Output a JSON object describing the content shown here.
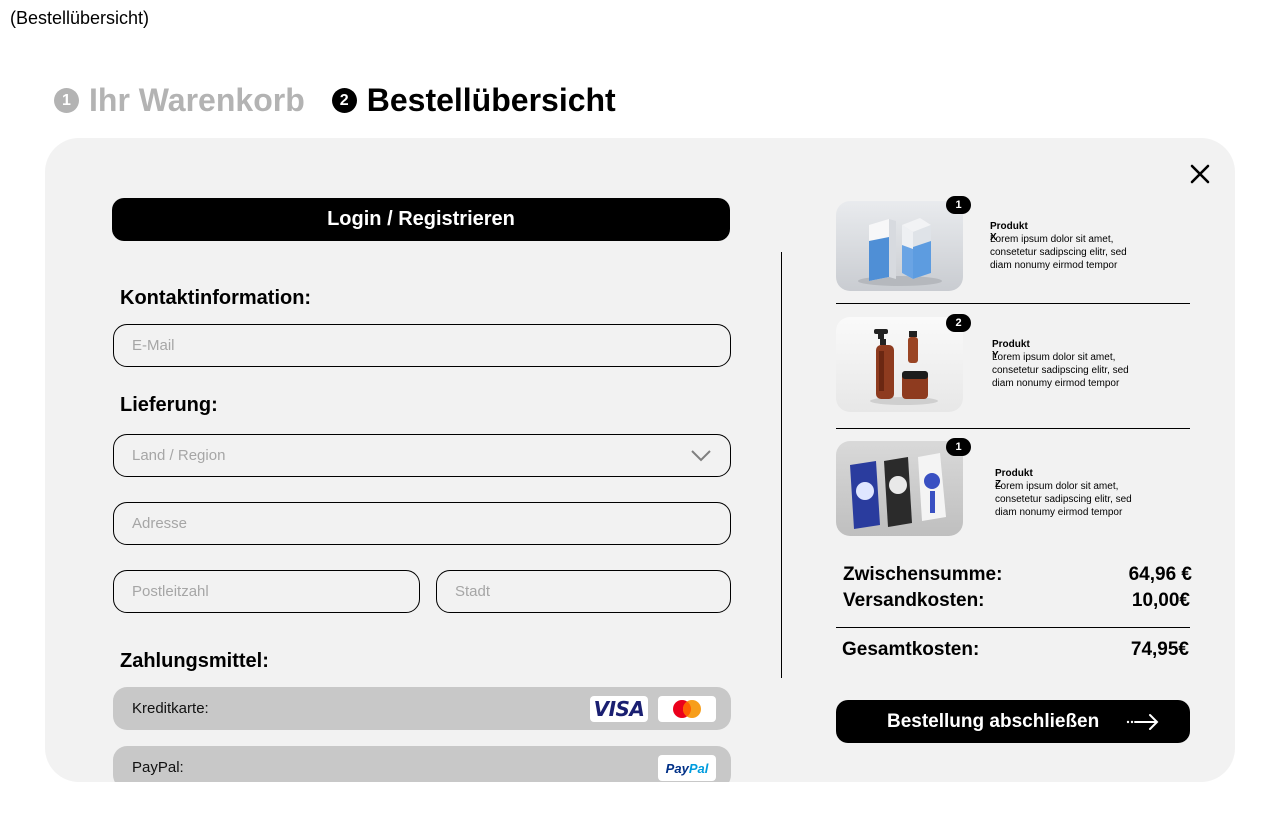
{
  "frame_label": "(Bestellübersicht)",
  "steps": [
    {
      "number": "1",
      "label": "Ihr Warenkorb"
    },
    {
      "number": "2",
      "label": "Bestellübersicht"
    }
  ],
  "form": {
    "login_label": "Login / Registrieren",
    "contact_title": "Kontaktinformation:",
    "email_placeholder": "E-Mail",
    "delivery_title": "Lieferung:",
    "country_placeholder": "Land / Region",
    "address_placeholder": "Adresse",
    "zip_placeholder": "Postleitzahl",
    "city_placeholder": "Stadt",
    "payment_title": "Zahlungsmittel:",
    "payment_options": [
      {
        "label": "Kreditkarte:"
      },
      {
        "label": "PayPal:"
      }
    ],
    "logos": {
      "visa": "VISA",
      "paypal_a": "Pay",
      "paypal_b": "Pal"
    }
  },
  "products": [
    {
      "qty": "1",
      "name": "Produkt X",
      "desc": "Lorem ipsum dolor sit amet, consetetur sadipscing elitr, sed diam nonumy eirmod tempor"
    },
    {
      "qty": "2",
      "name": "Produkt Y",
      "desc": "Lorem ipsum dolor sit amet, consetetur sadipscing elitr, sed diam nonumy eirmod tempor"
    },
    {
      "qty": "1",
      "name": "Produkt Z",
      "desc": "Lorem ipsum dolor sit amet, consetetur sadipscing elitr, sed diam nonumy eirmod tempor"
    }
  ],
  "summary": {
    "subtotal_label": "Zwischensumme:",
    "subtotal_value": "64,96 €",
    "shipping_label": "Versandkosten:",
    "shipping_value": "10,00€",
    "total_label": "Gesamtkosten:",
    "total_value": "74,95€"
  },
  "checkout_label": "Bestellung abschließen",
  "colors": {
    "panel": "#f2f2f2",
    "inactive": "#b3b3b3",
    "payment_row": "#c8c8c8",
    "visa_blue": "#1a1f71",
    "paypal_blue": "#003087"
  }
}
